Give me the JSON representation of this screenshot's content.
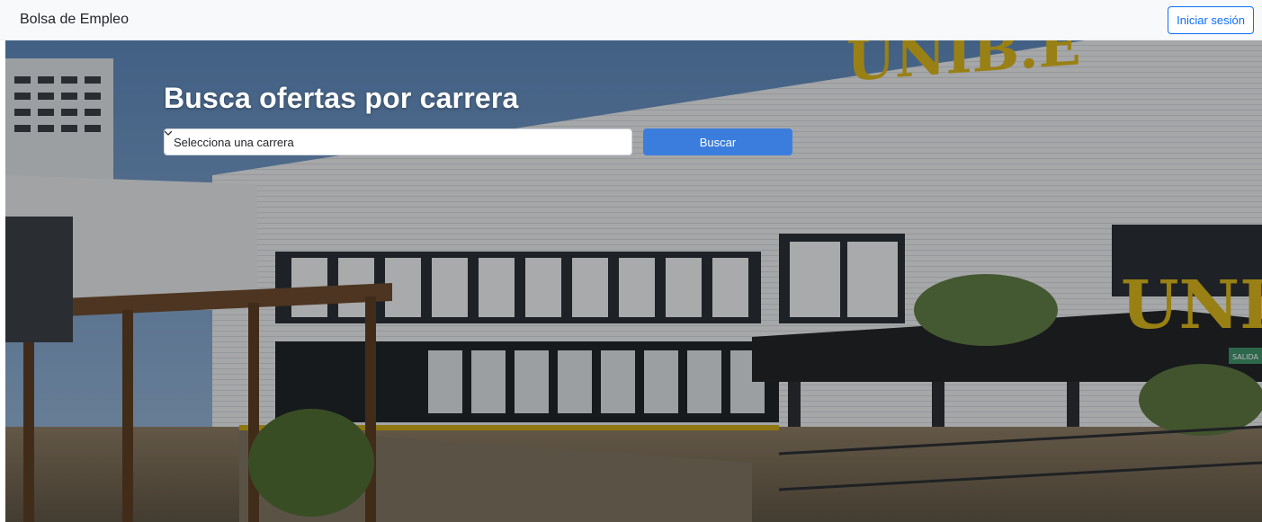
{
  "navbar": {
    "brand": "Bolsa de Empleo",
    "login_label": "Iniciar sesión"
  },
  "hero": {
    "title": "Busca ofertas por carrera",
    "select_placeholder": "Selecciona una carrera",
    "search_label": "Buscar",
    "sign_main": "UNIB.E",
    "sign_secondary": "UNI",
    "small_sign": "SALIDA"
  },
  "colors": {
    "accent": "#0d6efd",
    "search_button": "#3b7ddd",
    "navbar_bg": "#f8f9fa",
    "sign_yellow": "#d4b21c"
  },
  "icons": {
    "select_chevron": "chevron-down-icon"
  }
}
